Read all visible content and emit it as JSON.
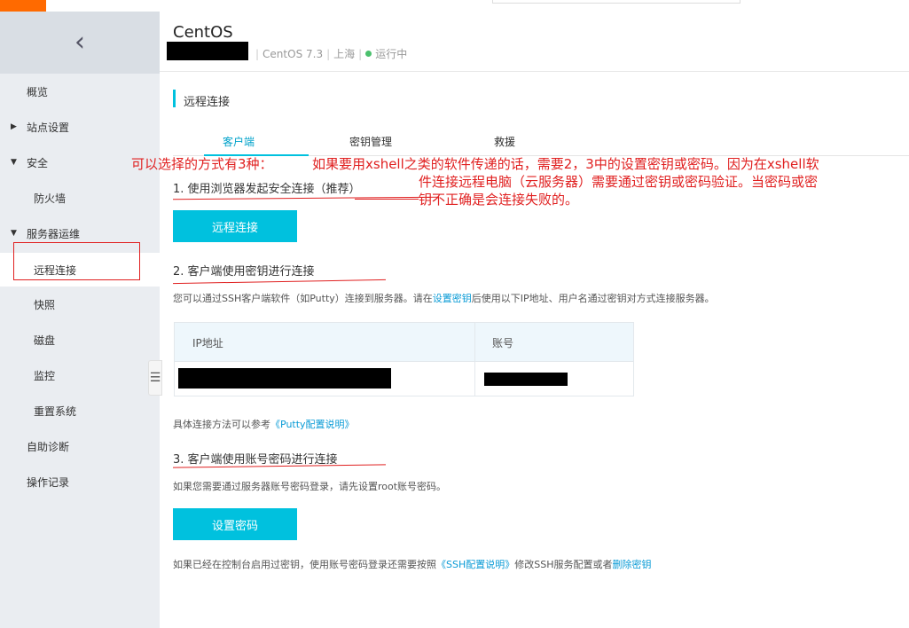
{
  "header": {
    "title": "CentOS",
    "os": "CentOS 7.3",
    "region": "上海",
    "status": "运行中",
    "status_color": "#4bc06d"
  },
  "sidebar": {
    "back_icon": "‹",
    "items": [
      {
        "label": "概览"
      },
      {
        "label": "站点设置"
      },
      {
        "label": "安全"
      },
      {
        "label": "防火墙"
      },
      {
        "label": "服务器运维"
      },
      {
        "label": "远程连接"
      },
      {
        "label": "快照"
      },
      {
        "label": "磁盘"
      },
      {
        "label": "监控"
      },
      {
        "label": "重置系统"
      },
      {
        "label": "自助诊断"
      },
      {
        "label": "操作记录"
      }
    ]
  },
  "section": {
    "title": "远程连接"
  },
  "tabs": [
    {
      "label": "客户端"
    },
    {
      "label": "密钥管理"
    },
    {
      "label": "救援"
    }
  ],
  "annotations": {
    "left": "可以选择的方式有3种：",
    "right_line1": "如果要用xshell之类的软件传递的话，需要2，3中的设置密钥或密码。因为在xshell软",
    "right_line2": "件连接远程电脑（云服务器）需要通过密钥或密码验证。当密码或密",
    "right_line3": "钥不正确是会连接失败的。"
  },
  "step1": {
    "heading": "1. 使用浏览器发起安全连接（推荐）",
    "button": "远程连接"
  },
  "step2": {
    "heading": "2. 客户端使用密钥进行连接",
    "desc_pre": "您可以通过SSH客户端软件（如Putty）连接到服务器。请在",
    "desc_link": "设置密钥",
    "desc_post": "后使用以下IP地址、用户名通过密钥对方式连接服务器。",
    "table_headers": {
      "ip": "IP地址",
      "account": "账号"
    },
    "ref_pre": "具体连接方法可以参考",
    "ref_link": "《Putty配置说明》"
  },
  "step3": {
    "heading": "3. 客户端使用账号密码进行连接",
    "desc": "如果您需要通过服务器账号密码登录，请先设置root账号密码。",
    "button": "设置密码",
    "note_pre": "如果已经在控制台启用过密钥，使用账号密码登录还需要按照",
    "note_link1": "《SSH配置说明》",
    "note_mid": "修改SSH服务配置或者",
    "note_link2": "删除密钥"
  },
  "colors": {
    "accent": "#00c1de",
    "brand_orange": "#ff6a00",
    "annotation_red": "#e02020",
    "link": "#0a9bd6"
  }
}
